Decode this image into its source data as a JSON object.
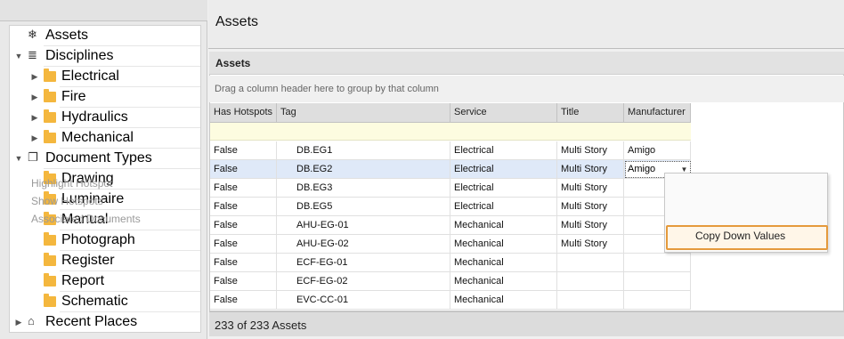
{
  "sidebar": {
    "tree": [
      {
        "label": "Assets",
        "icon": "snowflake-icon",
        "level": 0,
        "expander": ""
      },
      {
        "label": "Disciplines",
        "icon": "document-list-icon",
        "level": 0,
        "expander": "▼"
      },
      {
        "label": "Electrical",
        "icon": "folder-icon",
        "level": 1,
        "expander": "▶"
      },
      {
        "label": "Fire",
        "icon": "folder-icon",
        "level": 1,
        "expander": "▶"
      },
      {
        "label": "Hydraulics",
        "icon": "folder-icon",
        "level": 1,
        "expander": "▶"
      },
      {
        "label": "Mechanical",
        "icon": "folder-icon",
        "level": 1,
        "expander": "▶"
      },
      {
        "label": "Document Types",
        "icon": "documents-icon",
        "level": 0,
        "expander": "▼"
      },
      {
        "label": "Drawing",
        "icon": "folder-icon",
        "level": 1,
        "expander": ""
      },
      {
        "label": "Luminaire",
        "icon": "folder-icon",
        "level": 1,
        "expander": ""
      },
      {
        "label": "Manual",
        "icon": "folder-icon",
        "level": 1,
        "expander": ""
      },
      {
        "label": "Photograph",
        "icon": "folder-icon",
        "level": 1,
        "expander": ""
      },
      {
        "label": "Register",
        "icon": "folder-icon",
        "level": 1,
        "expander": ""
      },
      {
        "label": "Report",
        "icon": "folder-icon",
        "level": 1,
        "expander": ""
      },
      {
        "label": "Schematic",
        "icon": "folder-icon",
        "level": 1,
        "expander": ""
      },
      {
        "label": "Recent Places",
        "icon": "recent-places-icon",
        "level": 0,
        "expander": "▶"
      }
    ]
  },
  "header": {
    "title": "Assets"
  },
  "grid": {
    "caption": "Assets",
    "group_hint": "Drag a column header here to group by that column",
    "columns": [
      "Has Hotspots",
      "Tag",
      "Service",
      "Title",
      "Manufacturer"
    ],
    "rows": [
      [
        "False",
        "DB.EG1",
        "Electrical",
        "Multi Story",
        "Amigo"
      ],
      [
        "False",
        "DB.EG2",
        "Electrical",
        "Multi Story",
        "Amigo"
      ],
      [
        "False",
        "DB.EG3",
        "Electrical",
        "Multi Story",
        ""
      ],
      [
        "False",
        "DB.EG5",
        "Electrical",
        "Multi Story",
        ""
      ],
      [
        "False",
        "AHU-EG-01",
        "Mechanical",
        "Multi Story",
        ""
      ],
      [
        "False",
        "AHU-EG-02",
        "Mechanical",
        "Multi Story",
        ""
      ],
      [
        "False",
        "ECF-EG-01",
        "Mechanical",
        "",
        ""
      ],
      [
        "False",
        "ECF-EG-02",
        "Mechanical",
        "",
        ""
      ],
      [
        "False",
        "EVC-CC-01",
        "Mechanical",
        "",
        ""
      ]
    ],
    "selected_row": 1,
    "editor_value": "Amigo"
  },
  "status": {
    "text": "233 of 233 Assets"
  },
  "context_menu": {
    "items": [
      "Highlight Hotspot",
      "Show Hotspots",
      "Associated Documents"
    ],
    "highlighted": "Copy Down Values"
  },
  "colors": {
    "selection": "#dfe9f8",
    "filter_row": "#fdfce0",
    "menu_highlight_border": "#e59a3c",
    "folder": "#f4b73e"
  }
}
